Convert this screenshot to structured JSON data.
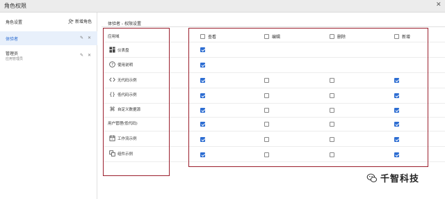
{
  "window": {
    "title": "角色权限",
    "close_glyph": "✕"
  },
  "sidebar": {
    "header_label": "角色设置",
    "add_label": "新增角色",
    "roles": [
      {
        "name": "体验者",
        "description": "",
        "selected": true
      },
      {
        "name": "管理员",
        "description": "应用管理员",
        "selected": false
      }
    ]
  },
  "main": {
    "panel_title": "体验者 - 权限设置",
    "resource_header": "应用域",
    "columns": [
      {
        "label": "查看",
        "checked": false
      },
      {
        "label": "编辑",
        "checked": false
      },
      {
        "label": "删除",
        "checked": false
      },
      {
        "label": "新增",
        "checked": false
      }
    ],
    "rows": [
      {
        "label": "仪表盘",
        "icon": "dashboard-icon",
        "perms": [
          true,
          null,
          null,
          null
        ]
      },
      {
        "label": "使用说明",
        "icon": "help-circle-icon",
        "perms": [
          true,
          null,
          null,
          null
        ]
      },
      {
        "label": "无代码示例",
        "icon": "code-brackets-icon",
        "perms": [
          true,
          false,
          false,
          true
        ]
      },
      {
        "label": "低代码示例",
        "icon": "curly-braces-icon",
        "perms": [
          true,
          false,
          false,
          true
        ]
      },
      {
        "label": "自定义数据源",
        "icon": "command-icon",
        "perms": [
          true,
          false,
          false,
          true
        ]
      },
      {
        "label": "用户管理(低代码)",
        "icon": "",
        "perms": [
          true,
          false,
          false,
          true
        ]
      },
      {
        "label": "工作流示例",
        "icon": "calendar-icon",
        "perms": [
          true,
          false,
          false,
          true
        ]
      },
      {
        "label": "组件示例",
        "icon": "component-icon",
        "perms": [
          true,
          false,
          false,
          true
        ]
      }
    ]
  },
  "watermark": {
    "text": "千智科技",
    "icon": "wechat-icon"
  },
  "colors": {
    "accent": "#2d6dd2",
    "highlight_box": "#9b1e2c",
    "selected_bg": "#e8f0fb"
  }
}
